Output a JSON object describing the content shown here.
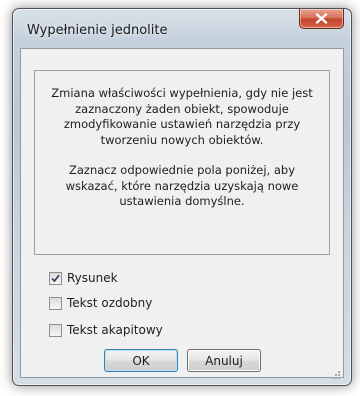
{
  "window": {
    "title": "Wypełnienie jednolite"
  },
  "icons": {
    "close": "close-icon",
    "check": "checkmark-icon",
    "grip": "resize-grip-icon"
  },
  "info": {
    "paragraph1": "Zmiana właściwości wypełnienia, gdy nie jest zaznaczony żaden obiekt, spowoduje zmodyfikowanie ustawień narzędzia przy tworzeniu nowych obiektów.",
    "paragraph2": "Zaznacz odpowiednie pola poniżej, aby wskazać, które narzędzia uzyskają nowe ustawienia domyślne."
  },
  "options": [
    {
      "label": "Rysunek",
      "checked": true
    },
    {
      "label": "Tekst ozdobny",
      "checked": false
    },
    {
      "label": "Tekst akapitowy",
      "checked": false
    }
  ],
  "buttons": {
    "ok": "OK",
    "cancel": "Anuluj"
  },
  "colors": {
    "close_button": "#c9553d",
    "default_button_border": "#3c7fb1",
    "client_background": "#f0f0f0"
  }
}
